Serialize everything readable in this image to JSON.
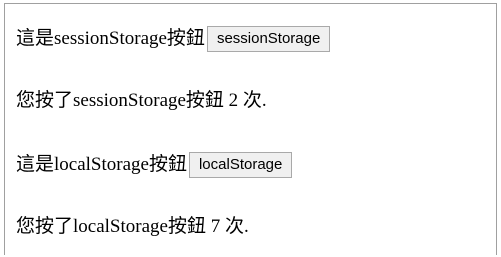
{
  "rows": [
    {
      "text": "這是sessionStorage按鈕",
      "button_label": "sessionStorage"
    },
    {
      "text": "您按了sessionStorage按鈕 2 次."
    },
    {
      "text": "這是localStorage按鈕",
      "button_label": "localStorage"
    },
    {
      "text": "您按了localStorage按鈕 7 次."
    }
  ]
}
